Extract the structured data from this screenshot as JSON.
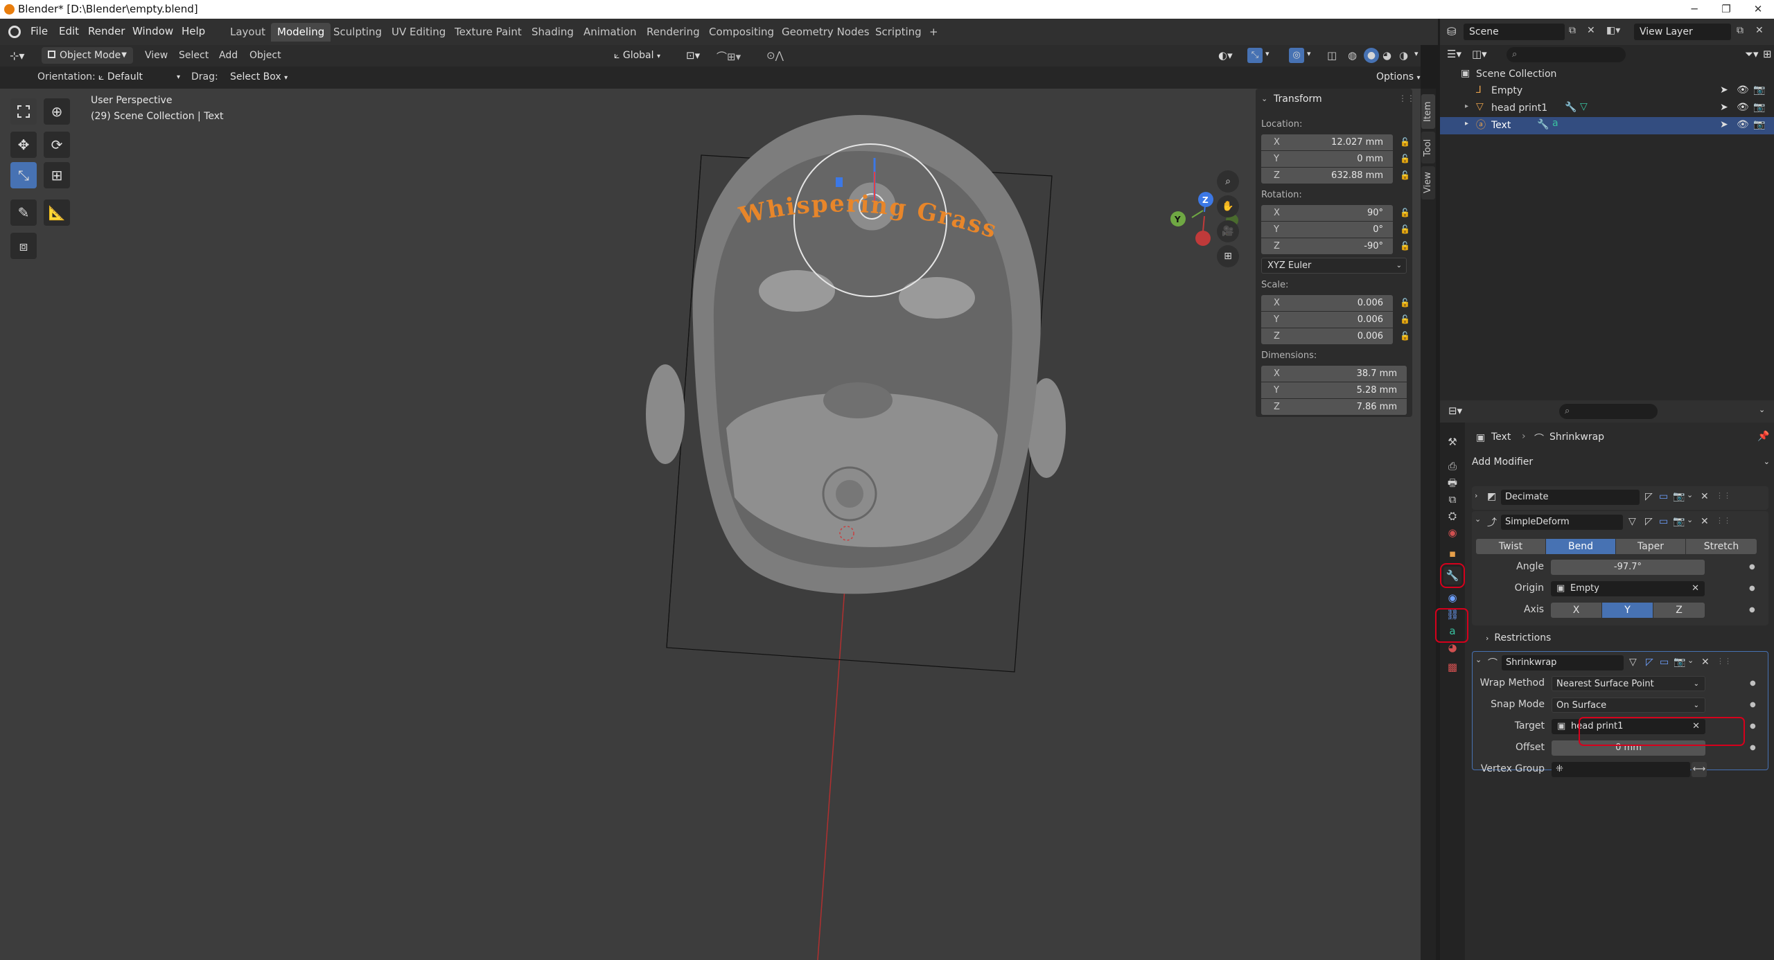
{
  "window": {
    "title": "Blender* [D:\\Blender\\empty.blend]",
    "minimize": "─",
    "maximize": "❐",
    "close": "✕"
  },
  "menu": [
    "File",
    "Edit",
    "Render",
    "Window",
    "Help"
  ],
  "workspaces": [
    "Layout",
    "Modeling",
    "Sculpting",
    "UV Editing",
    "Texture Paint",
    "Shading",
    "Animation",
    "Rendering",
    "Compositing",
    "Geometry Nodes",
    "Scripting",
    "+"
  ],
  "active_workspace": "Modeling",
  "scene": {
    "scene_name": "Scene",
    "view_layer": "View Layer"
  },
  "viewport_header": {
    "mode": "Object Mode",
    "menus": [
      "View",
      "Select",
      "Add",
      "Object"
    ],
    "transform_orientation": "Global",
    "options": "Options",
    "orientation_label": "Orientation:",
    "orientation_value": "Default",
    "drag_label": "Drag:",
    "drag_value": "Select Box"
  },
  "viewport_info": {
    "line1": "User Perspective",
    "line2": "(29) Scene Collection | Text"
  },
  "text_object_label": "Whispering Grass",
  "gizmo": {
    "x": "X",
    "y": "Y",
    "z": "Z"
  },
  "transform_panel": {
    "title": "Transform",
    "location_label": "Location:",
    "location": [
      {
        "axis": "X",
        "value": "12.027 mm"
      },
      {
        "axis": "Y",
        "value": "0 mm"
      },
      {
        "axis": "Z",
        "value": "632.88 mm"
      }
    ],
    "rotation_label": "Rotation:",
    "rotation": [
      {
        "axis": "X",
        "value": "90°"
      },
      {
        "axis": "Y",
        "value": "0°"
      },
      {
        "axis": "Z",
        "value": "-90°"
      }
    ],
    "rotation_mode": "XYZ Euler",
    "scale_label": "Scale:",
    "scale": [
      {
        "axis": "X",
        "value": "0.006"
      },
      {
        "axis": "Y",
        "value": "0.006"
      },
      {
        "axis": "Z",
        "value": "0.006"
      }
    ],
    "dimensions_label": "Dimensions:",
    "dimensions": [
      {
        "axis": "X",
        "value": "38.7 mm"
      },
      {
        "axis": "Y",
        "value": "5.28 mm"
      },
      {
        "axis": "Z",
        "value": "7.86 mm"
      }
    ]
  },
  "npanel_tabs": [
    "Item",
    "Tool",
    "View"
  ],
  "outliner": {
    "root": "Scene Collection",
    "items": [
      {
        "name": "Empty",
        "selected": false
      },
      {
        "name": "head print1",
        "selected": false
      },
      {
        "name": "Text",
        "selected": true
      }
    ]
  },
  "properties": {
    "breadcrumb_object": "Text",
    "breadcrumb_modifier": "Shrinkwrap",
    "add_modifier": "Add Modifier",
    "modifiers": {
      "decimate": {
        "name": "Decimate"
      },
      "simpledeform": {
        "name": "SimpleDeform",
        "modes": [
          "Twist",
          "Bend",
          "Taper",
          "Stretch"
        ],
        "active_mode": "Bend",
        "angle_label": "Angle",
        "angle": "-97.7°",
        "origin_label": "Origin",
        "origin": "Empty",
        "axis_label": "Axis",
        "axes": [
          "X",
          "Y",
          "Z"
        ],
        "active_axis": "Y",
        "restrictions": "Restrictions"
      },
      "shrinkwrap": {
        "name": "Shrinkwrap",
        "wrap_method_label": "Wrap Method",
        "wrap_method": "Nearest Surface Point",
        "snap_mode_label": "Snap Mode",
        "snap_mode": "On Surface",
        "target_label": "Target",
        "target": "head print1",
        "offset_label": "Offset",
        "offset": "0 mm",
        "vertex_group_label": "Vertex Group"
      }
    }
  },
  "colors": {
    "accent_blue": "#4772b3",
    "highlight_red": "#d6001c",
    "text_orange": "#e8862a"
  }
}
